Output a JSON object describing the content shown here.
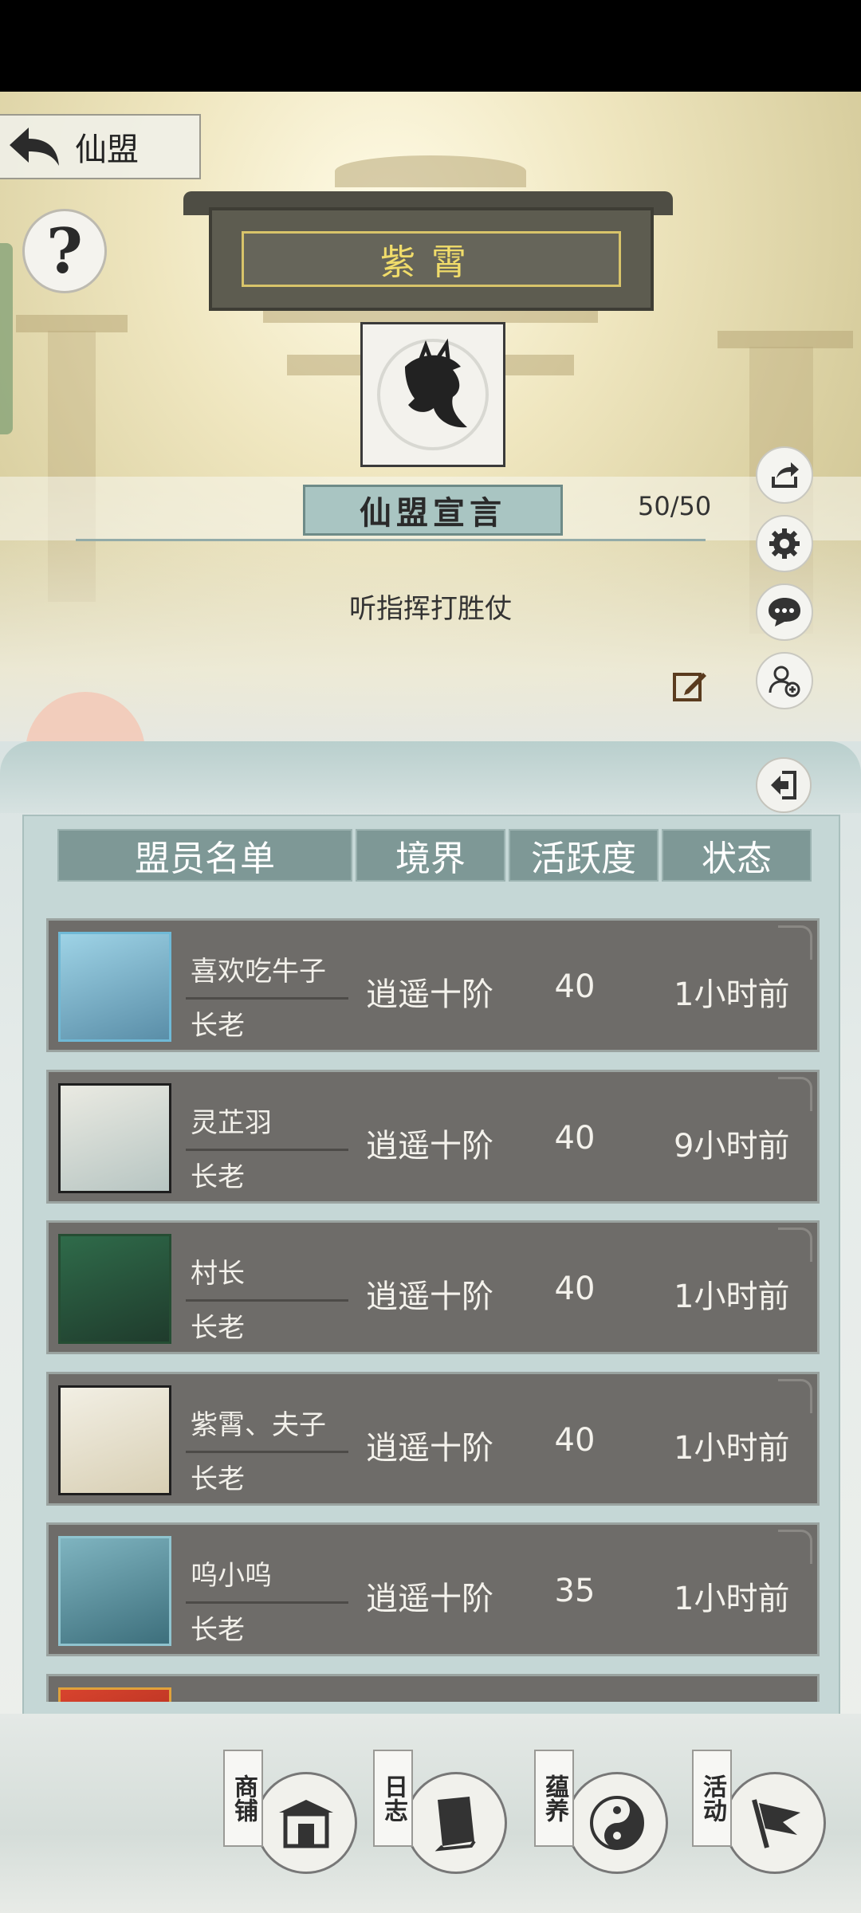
{
  "header": {
    "title": "仙盟"
  },
  "alliance": {
    "name": "紫霄",
    "declaration_title": "仙盟宣言",
    "member_count": "50/50",
    "declaration": "听指挥打胜仗"
  },
  "side_buttons": [
    "share-icon",
    "gear-icon",
    "chat-icon",
    "add-user-icon"
  ],
  "table": {
    "headers": [
      "盟员名单",
      "境界",
      "活跃度",
      "状态"
    ],
    "rows": [
      {
        "name": "喜欢吃牛子",
        "role": "长老",
        "realm": "逍遥十阶",
        "activity": "40",
        "status": "1小时前"
      },
      {
        "name": "灵芷羽",
        "role": "长老",
        "realm": "逍遥十阶",
        "activity": "40",
        "status": "9小时前"
      },
      {
        "name": "村长",
        "role": "长老",
        "realm": "逍遥十阶",
        "activity": "40",
        "status": "1小时前"
      },
      {
        "name": "紫霄、夫子",
        "role": "长老",
        "realm": "逍遥十阶",
        "activity": "40",
        "status": "1小时前"
      },
      {
        "name": "呜小呜",
        "role": "长老",
        "realm": "逍遥十阶",
        "activity": "35",
        "status": "1小时前"
      }
    ]
  },
  "nav": [
    {
      "label": "商铺",
      "icon": "shop-icon"
    },
    {
      "label": "日志",
      "icon": "book-icon"
    },
    {
      "label": "蕴养",
      "icon": "yin-yang-icon"
    },
    {
      "label": "活动",
      "icon": "flag-icon"
    }
  ]
}
